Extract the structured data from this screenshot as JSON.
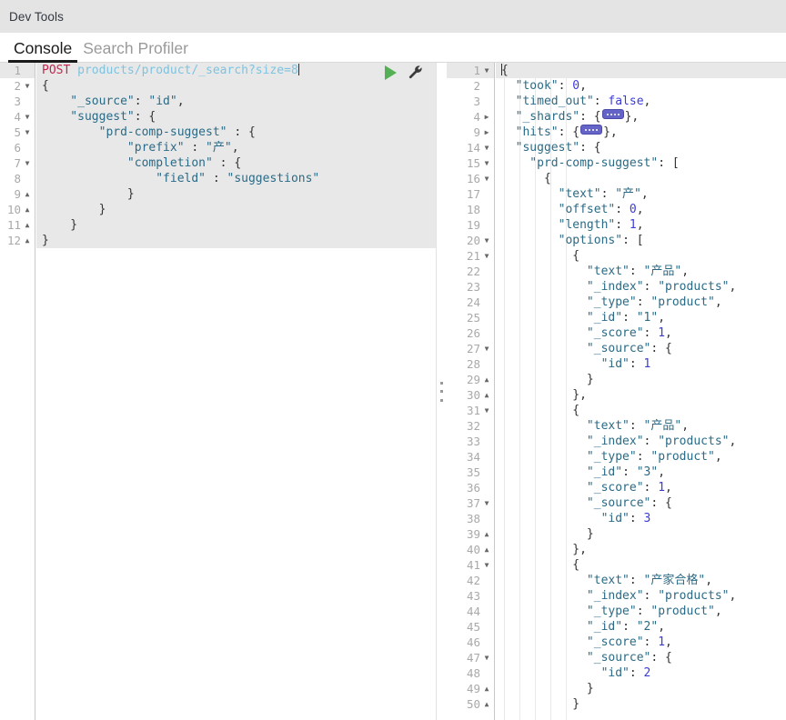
{
  "app": {
    "title": "Dev Tools"
  },
  "tabs": [
    {
      "label": "Console",
      "active": true
    },
    {
      "label": "Search Profiler",
      "active": false
    }
  ],
  "toolbar": {
    "run_label": "play-icon",
    "wrench_label": "wrench-icon"
  },
  "request_editor": {
    "method": "POST",
    "url": "products/product/_search?size=8",
    "lines": [
      {
        "n": 1,
        "fold": "none",
        "highlight": true,
        "tokens": [
          {
            "t": "method",
            "v": "POST"
          },
          {
            "t": "plain",
            "v": " "
          },
          {
            "t": "url",
            "v": "products/product/_search?size=8"
          },
          {
            "t": "caret",
            "v": ""
          }
        ]
      },
      {
        "n": 2,
        "fold": "open",
        "highlight": true,
        "tokens": [
          {
            "t": "punct",
            "v": "{"
          }
        ]
      },
      {
        "n": 3,
        "fold": "none",
        "highlight": true,
        "tokens": [
          {
            "t": "key",
            "v": "    \"_source\""
          },
          {
            "t": "punct",
            "v": ": "
          },
          {
            "t": "string",
            "v": "\"id\""
          },
          {
            "t": "punct",
            "v": ","
          }
        ]
      },
      {
        "n": 4,
        "fold": "open",
        "highlight": true,
        "tokens": [
          {
            "t": "key",
            "v": "    \"suggest\""
          },
          {
            "t": "punct",
            "v": ": {"
          }
        ]
      },
      {
        "n": 5,
        "fold": "open",
        "highlight": true,
        "tokens": [
          {
            "t": "key",
            "v": "        \"prd-comp-suggest\""
          },
          {
            "t": "punct",
            "v": " : {"
          }
        ]
      },
      {
        "n": 6,
        "fold": "none",
        "highlight": true,
        "tokens": [
          {
            "t": "key",
            "v": "            \"prefix\""
          },
          {
            "t": "punct",
            "v": " : "
          },
          {
            "t": "string",
            "v": "\"产\""
          },
          {
            "t": "punct",
            "v": ","
          }
        ]
      },
      {
        "n": 7,
        "fold": "open",
        "highlight": true,
        "tokens": [
          {
            "t": "key",
            "v": "            \"completion\""
          },
          {
            "t": "punct",
            "v": " : {"
          }
        ]
      },
      {
        "n": 8,
        "fold": "none",
        "highlight": true,
        "tokens": [
          {
            "t": "key",
            "v": "                \"field\""
          },
          {
            "t": "punct",
            "v": " : "
          },
          {
            "t": "string",
            "v": "\"suggestions\""
          }
        ]
      },
      {
        "n": 9,
        "fold": "close",
        "highlight": true,
        "tokens": [
          {
            "t": "punct",
            "v": "            }"
          }
        ]
      },
      {
        "n": 10,
        "fold": "close",
        "highlight": true,
        "tokens": [
          {
            "t": "punct",
            "v": "        }"
          }
        ]
      },
      {
        "n": 11,
        "fold": "close",
        "highlight": true,
        "tokens": [
          {
            "t": "punct",
            "v": "    }"
          }
        ]
      },
      {
        "n": 12,
        "fold": "close",
        "highlight": true,
        "tokens": [
          {
            "t": "punct",
            "v": "}"
          }
        ]
      }
    ]
  },
  "response_editor": {
    "lines": [
      {
        "n": 1,
        "fold": "open",
        "highlight": true,
        "tokens": [
          {
            "t": "caret-pre",
            "v": ""
          },
          {
            "t": "punct",
            "v": "{"
          }
        ]
      },
      {
        "n": 2,
        "fold": "none",
        "highlight": false,
        "tokens": [
          {
            "t": "key",
            "v": "  \"took\""
          },
          {
            "t": "punct",
            "v": ": "
          },
          {
            "t": "num",
            "v": "0"
          },
          {
            "t": "punct",
            "v": ","
          }
        ]
      },
      {
        "n": 3,
        "fold": "none",
        "highlight": false,
        "tokens": [
          {
            "t": "key",
            "v": "  \"timed_out\""
          },
          {
            "t": "punct",
            "v": ": "
          },
          {
            "t": "bool",
            "v": "false"
          },
          {
            "t": "punct",
            "v": ","
          }
        ]
      },
      {
        "n": 4,
        "fold": "collapsed",
        "highlight": false,
        "tokens": [
          {
            "t": "key",
            "v": "  \"_shards\""
          },
          {
            "t": "punct",
            "v": ": {"
          },
          {
            "t": "widget",
            "v": ""
          },
          {
            "t": "punct",
            "v": "},"
          }
        ]
      },
      {
        "n": 9,
        "fold": "collapsed",
        "highlight": false,
        "tokens": [
          {
            "t": "key",
            "v": "  \"hits\""
          },
          {
            "t": "punct",
            "v": ": {"
          },
          {
            "t": "widget",
            "v": ""
          },
          {
            "t": "punct",
            "v": "},"
          }
        ]
      },
      {
        "n": 14,
        "fold": "open",
        "highlight": false,
        "tokens": [
          {
            "t": "key",
            "v": "  \"suggest\""
          },
          {
            "t": "punct",
            "v": ": {"
          }
        ]
      },
      {
        "n": 15,
        "fold": "open",
        "highlight": false,
        "tokens": [
          {
            "t": "key",
            "v": "    \"prd-comp-suggest\""
          },
          {
            "t": "punct",
            "v": ": ["
          }
        ]
      },
      {
        "n": 16,
        "fold": "open",
        "highlight": false,
        "tokens": [
          {
            "t": "punct",
            "v": "      {"
          }
        ]
      },
      {
        "n": 17,
        "fold": "none",
        "highlight": false,
        "tokens": [
          {
            "t": "key",
            "v": "        \"text\""
          },
          {
            "t": "punct",
            "v": ": "
          },
          {
            "t": "string",
            "v": "\"产\""
          },
          {
            "t": "punct",
            "v": ","
          }
        ]
      },
      {
        "n": 18,
        "fold": "none",
        "highlight": false,
        "tokens": [
          {
            "t": "key",
            "v": "        \"offset\""
          },
          {
            "t": "punct",
            "v": ": "
          },
          {
            "t": "num",
            "v": "0"
          },
          {
            "t": "punct",
            "v": ","
          }
        ]
      },
      {
        "n": 19,
        "fold": "none",
        "highlight": false,
        "tokens": [
          {
            "t": "key",
            "v": "        \"length\""
          },
          {
            "t": "punct",
            "v": ": "
          },
          {
            "t": "num",
            "v": "1"
          },
          {
            "t": "punct",
            "v": ","
          }
        ]
      },
      {
        "n": 20,
        "fold": "open",
        "highlight": false,
        "tokens": [
          {
            "t": "key",
            "v": "        \"options\""
          },
          {
            "t": "punct",
            "v": ": ["
          }
        ]
      },
      {
        "n": 21,
        "fold": "open",
        "highlight": false,
        "tokens": [
          {
            "t": "punct",
            "v": "          {"
          }
        ]
      },
      {
        "n": 22,
        "fold": "none",
        "highlight": false,
        "tokens": [
          {
            "t": "key",
            "v": "            \"text\""
          },
          {
            "t": "punct",
            "v": ": "
          },
          {
            "t": "string",
            "v": "\"产品\""
          },
          {
            "t": "punct",
            "v": ","
          }
        ]
      },
      {
        "n": 23,
        "fold": "none",
        "highlight": false,
        "tokens": [
          {
            "t": "key",
            "v": "            \"_index\""
          },
          {
            "t": "punct",
            "v": ": "
          },
          {
            "t": "string",
            "v": "\"products\""
          },
          {
            "t": "punct",
            "v": ","
          }
        ]
      },
      {
        "n": 24,
        "fold": "none",
        "highlight": false,
        "tokens": [
          {
            "t": "key",
            "v": "            \"_type\""
          },
          {
            "t": "punct",
            "v": ": "
          },
          {
            "t": "string",
            "v": "\"product\""
          },
          {
            "t": "punct",
            "v": ","
          }
        ]
      },
      {
        "n": 25,
        "fold": "none",
        "highlight": false,
        "tokens": [
          {
            "t": "key",
            "v": "            \"_id\""
          },
          {
            "t": "punct",
            "v": ": "
          },
          {
            "t": "string",
            "v": "\"1\""
          },
          {
            "t": "punct",
            "v": ","
          }
        ]
      },
      {
        "n": 26,
        "fold": "none",
        "highlight": false,
        "tokens": [
          {
            "t": "key",
            "v": "            \"_score\""
          },
          {
            "t": "punct",
            "v": ": "
          },
          {
            "t": "num",
            "v": "1"
          },
          {
            "t": "punct",
            "v": ","
          }
        ]
      },
      {
        "n": 27,
        "fold": "open",
        "highlight": false,
        "tokens": [
          {
            "t": "key",
            "v": "            \"_source\""
          },
          {
            "t": "punct",
            "v": ": {"
          }
        ]
      },
      {
        "n": 28,
        "fold": "none",
        "highlight": false,
        "tokens": [
          {
            "t": "key",
            "v": "              \"id\""
          },
          {
            "t": "punct",
            "v": ": "
          },
          {
            "t": "num",
            "v": "1"
          }
        ]
      },
      {
        "n": 29,
        "fold": "close",
        "highlight": false,
        "tokens": [
          {
            "t": "punct",
            "v": "            }"
          }
        ]
      },
      {
        "n": 30,
        "fold": "close",
        "highlight": false,
        "tokens": [
          {
            "t": "punct",
            "v": "          },"
          }
        ]
      },
      {
        "n": 31,
        "fold": "open",
        "highlight": false,
        "tokens": [
          {
            "t": "punct",
            "v": "          {"
          }
        ]
      },
      {
        "n": 32,
        "fold": "none",
        "highlight": false,
        "tokens": [
          {
            "t": "key",
            "v": "            \"text\""
          },
          {
            "t": "punct",
            "v": ": "
          },
          {
            "t": "string",
            "v": "\"产品\""
          },
          {
            "t": "punct",
            "v": ","
          }
        ]
      },
      {
        "n": 33,
        "fold": "none",
        "highlight": false,
        "tokens": [
          {
            "t": "key",
            "v": "            \"_index\""
          },
          {
            "t": "punct",
            "v": ": "
          },
          {
            "t": "string",
            "v": "\"products\""
          },
          {
            "t": "punct",
            "v": ","
          }
        ]
      },
      {
        "n": 34,
        "fold": "none",
        "highlight": false,
        "tokens": [
          {
            "t": "key",
            "v": "            \"_type\""
          },
          {
            "t": "punct",
            "v": ": "
          },
          {
            "t": "string",
            "v": "\"product\""
          },
          {
            "t": "punct",
            "v": ","
          }
        ]
      },
      {
        "n": 35,
        "fold": "none",
        "highlight": false,
        "tokens": [
          {
            "t": "key",
            "v": "            \"_id\""
          },
          {
            "t": "punct",
            "v": ": "
          },
          {
            "t": "string",
            "v": "\"3\""
          },
          {
            "t": "punct",
            "v": ","
          }
        ]
      },
      {
        "n": 36,
        "fold": "none",
        "highlight": false,
        "tokens": [
          {
            "t": "key",
            "v": "            \"_score\""
          },
          {
            "t": "punct",
            "v": ": "
          },
          {
            "t": "num",
            "v": "1"
          },
          {
            "t": "punct",
            "v": ","
          }
        ]
      },
      {
        "n": 37,
        "fold": "open",
        "highlight": false,
        "tokens": [
          {
            "t": "key",
            "v": "            \"_source\""
          },
          {
            "t": "punct",
            "v": ": {"
          }
        ]
      },
      {
        "n": 38,
        "fold": "none",
        "highlight": false,
        "tokens": [
          {
            "t": "key",
            "v": "              \"id\""
          },
          {
            "t": "punct",
            "v": ": "
          },
          {
            "t": "num",
            "v": "3"
          }
        ]
      },
      {
        "n": 39,
        "fold": "close",
        "highlight": false,
        "tokens": [
          {
            "t": "punct",
            "v": "            }"
          }
        ]
      },
      {
        "n": 40,
        "fold": "close",
        "highlight": false,
        "tokens": [
          {
            "t": "punct",
            "v": "          },"
          }
        ]
      },
      {
        "n": 41,
        "fold": "open",
        "highlight": false,
        "tokens": [
          {
            "t": "punct",
            "v": "          {"
          }
        ]
      },
      {
        "n": 42,
        "fold": "none",
        "highlight": false,
        "tokens": [
          {
            "t": "key",
            "v": "            \"text\""
          },
          {
            "t": "punct",
            "v": ": "
          },
          {
            "t": "string",
            "v": "\"产家合格\""
          },
          {
            "t": "punct",
            "v": ","
          }
        ]
      },
      {
        "n": 43,
        "fold": "none",
        "highlight": false,
        "tokens": [
          {
            "t": "key",
            "v": "            \"_index\""
          },
          {
            "t": "punct",
            "v": ": "
          },
          {
            "t": "string",
            "v": "\"products\""
          },
          {
            "t": "punct",
            "v": ","
          }
        ]
      },
      {
        "n": 44,
        "fold": "none",
        "highlight": false,
        "tokens": [
          {
            "t": "key",
            "v": "            \"_type\""
          },
          {
            "t": "punct",
            "v": ": "
          },
          {
            "t": "string",
            "v": "\"product\""
          },
          {
            "t": "punct",
            "v": ","
          }
        ]
      },
      {
        "n": 45,
        "fold": "none",
        "highlight": false,
        "tokens": [
          {
            "t": "key",
            "v": "            \"_id\""
          },
          {
            "t": "punct",
            "v": ": "
          },
          {
            "t": "string",
            "v": "\"2\""
          },
          {
            "t": "punct",
            "v": ","
          }
        ]
      },
      {
        "n": 46,
        "fold": "none",
        "highlight": false,
        "tokens": [
          {
            "t": "key",
            "v": "            \"_score\""
          },
          {
            "t": "punct",
            "v": ": "
          },
          {
            "t": "num",
            "v": "1"
          },
          {
            "t": "punct",
            "v": ","
          }
        ]
      },
      {
        "n": 47,
        "fold": "open",
        "highlight": false,
        "tokens": [
          {
            "t": "key",
            "v": "            \"_source\""
          },
          {
            "t": "punct",
            "v": ": {"
          }
        ]
      },
      {
        "n": 48,
        "fold": "none",
        "highlight": false,
        "tokens": [
          {
            "t": "key",
            "v": "              \"id\""
          },
          {
            "t": "punct",
            "v": ": "
          },
          {
            "t": "num",
            "v": "2"
          }
        ]
      },
      {
        "n": 49,
        "fold": "close",
        "highlight": false,
        "tokens": [
          {
            "t": "punct",
            "v": "            }"
          }
        ]
      },
      {
        "n": 50,
        "fold": "close",
        "highlight": false,
        "tokens": [
          {
            "t": "punct",
            "v": "          }"
          }
        ]
      }
    ]
  },
  "colors": {
    "header_bg": "#e4e4e4",
    "editor_highlight": "#e8e8e8",
    "method": "#c7254e",
    "url": "#7fc3e0",
    "json_key": "#2b6a86",
    "json_number": "#3b3bdb",
    "run_button": "#54b054",
    "fold_widget": "#6464c8"
  }
}
